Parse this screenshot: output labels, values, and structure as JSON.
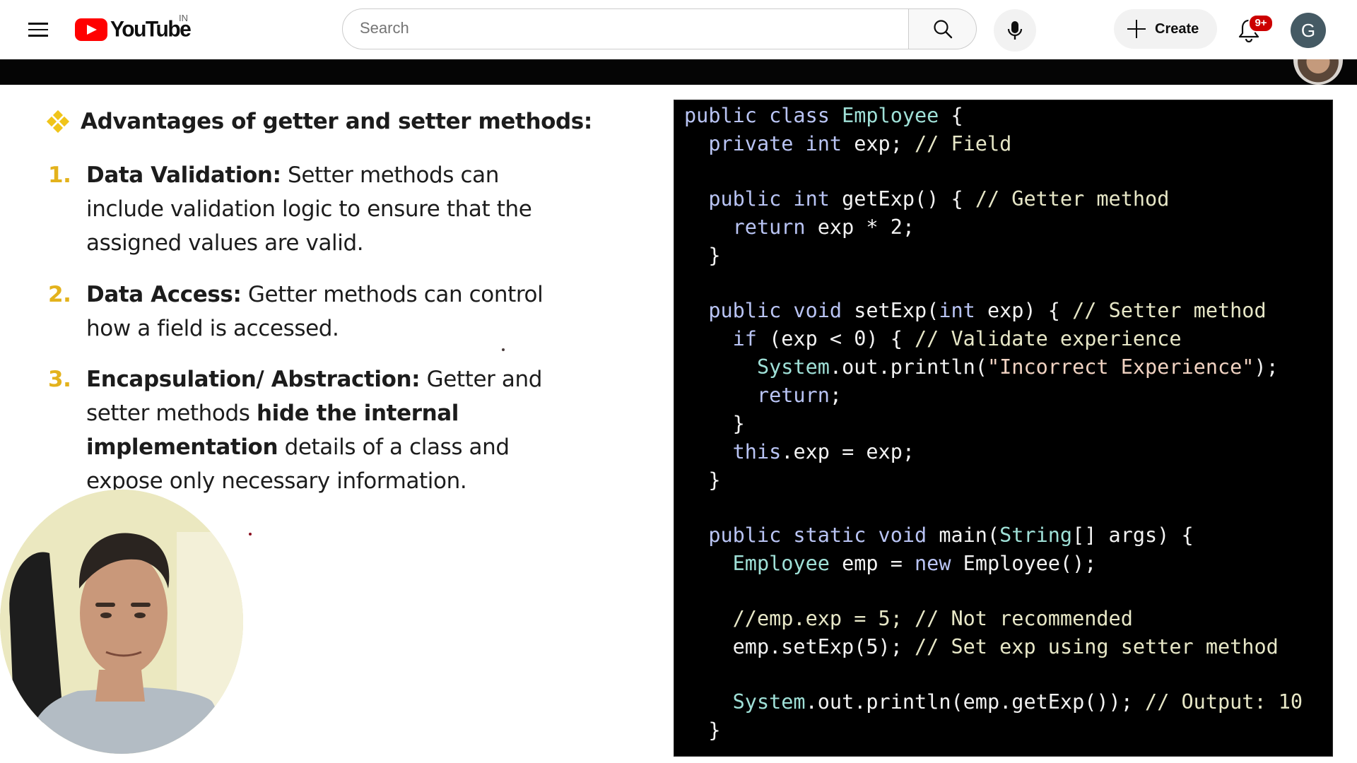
{
  "header": {
    "logo_text": "YouTube",
    "country_code": "IN",
    "search_placeholder": "Search",
    "create_label": "Create",
    "notification_count": "9+",
    "avatar_letter": "G"
  },
  "slide": {
    "heading": "Advantages of getter and setter methods:",
    "points": [
      {
        "number": "1.",
        "title": "Data Validation:",
        "text": "Setter methods can include validation logic to ensure that the assigned values are valid."
      },
      {
        "number": "2.",
        "title": "Data Access:",
        "text": "Getter methods can control how a field is accessed."
      },
      {
        "number": "3.",
        "title": "Encapsulation/ Abstraction:",
        "text_before": "Getter and setter methods",
        "emphasis": "hide the internal implementation",
        "text_after": "details of a class and expose only necessary information."
      }
    ]
  },
  "code": {
    "lines": [
      [
        [
          "public class ",
          "kw"
        ],
        [
          "Employee",
          "ty"
        ],
        [
          " {",
          ""
        ]
      ],
      [
        [
          "  private int ",
          "kw"
        ],
        [
          "exp; ",
          ""
        ],
        [
          "// Field",
          "cm"
        ]
      ],
      [],
      [
        [
          "  public int ",
          "kw"
        ],
        [
          "getExp() { ",
          ""
        ],
        [
          "// Getter method",
          "cm"
        ]
      ],
      [
        [
          "    return ",
          "kw"
        ],
        [
          "exp * 2;",
          ""
        ]
      ],
      [
        [
          "  }",
          ""
        ]
      ],
      [],
      [
        [
          "  public void ",
          "kw"
        ],
        [
          "setExp(",
          ""
        ],
        [
          "int",
          "kw"
        ],
        [
          " exp) { ",
          ""
        ],
        [
          "// Setter method",
          "cm"
        ]
      ],
      [
        [
          "    if ",
          "kw"
        ],
        [
          "(exp < 0) { ",
          ""
        ],
        [
          "// Validate experience",
          "cm"
        ]
      ],
      [
        [
          "      System",
          "ty"
        ],
        [
          ".out.println(",
          ""
        ],
        [
          "\"Incorrect Experience\"",
          "st"
        ],
        [
          ");",
          ""
        ]
      ],
      [
        [
          "      return",
          "kw"
        ],
        [
          ";",
          ""
        ]
      ],
      [
        [
          "    }",
          ""
        ]
      ],
      [
        [
          "    this",
          "kw"
        ],
        [
          ".exp = exp;",
          ""
        ]
      ],
      [
        [
          "  }",
          ""
        ]
      ],
      [],
      [
        [
          "  public static void ",
          "kw"
        ],
        [
          "main(",
          ""
        ],
        [
          "String",
          "ty"
        ],
        [
          "[] args) {",
          ""
        ]
      ],
      [
        [
          "    Employee",
          "ty"
        ],
        [
          " emp = ",
          ""
        ],
        [
          "new",
          "kw"
        ],
        [
          " Employee();",
          ""
        ]
      ],
      [],
      [
        [
          "    //emp.exp = 5; // Not recommended",
          "cm"
        ]
      ],
      [
        [
          "    emp.setExp(5); ",
          ""
        ],
        [
          "// Set exp using setter method",
          "cm"
        ]
      ],
      [],
      [
        [
          "    System",
          "ty"
        ],
        [
          ".out.println(emp.getExp()); ",
          ""
        ],
        [
          "// Output: 10",
          "cm"
        ]
      ],
      [
        [
          "  }",
          ""
        ]
      ]
    ]
  },
  "icons": [
    "menu-icon",
    "youtube-logo-icon",
    "search-icon",
    "mic-icon",
    "plus-icon",
    "bell-icon"
  ]
}
